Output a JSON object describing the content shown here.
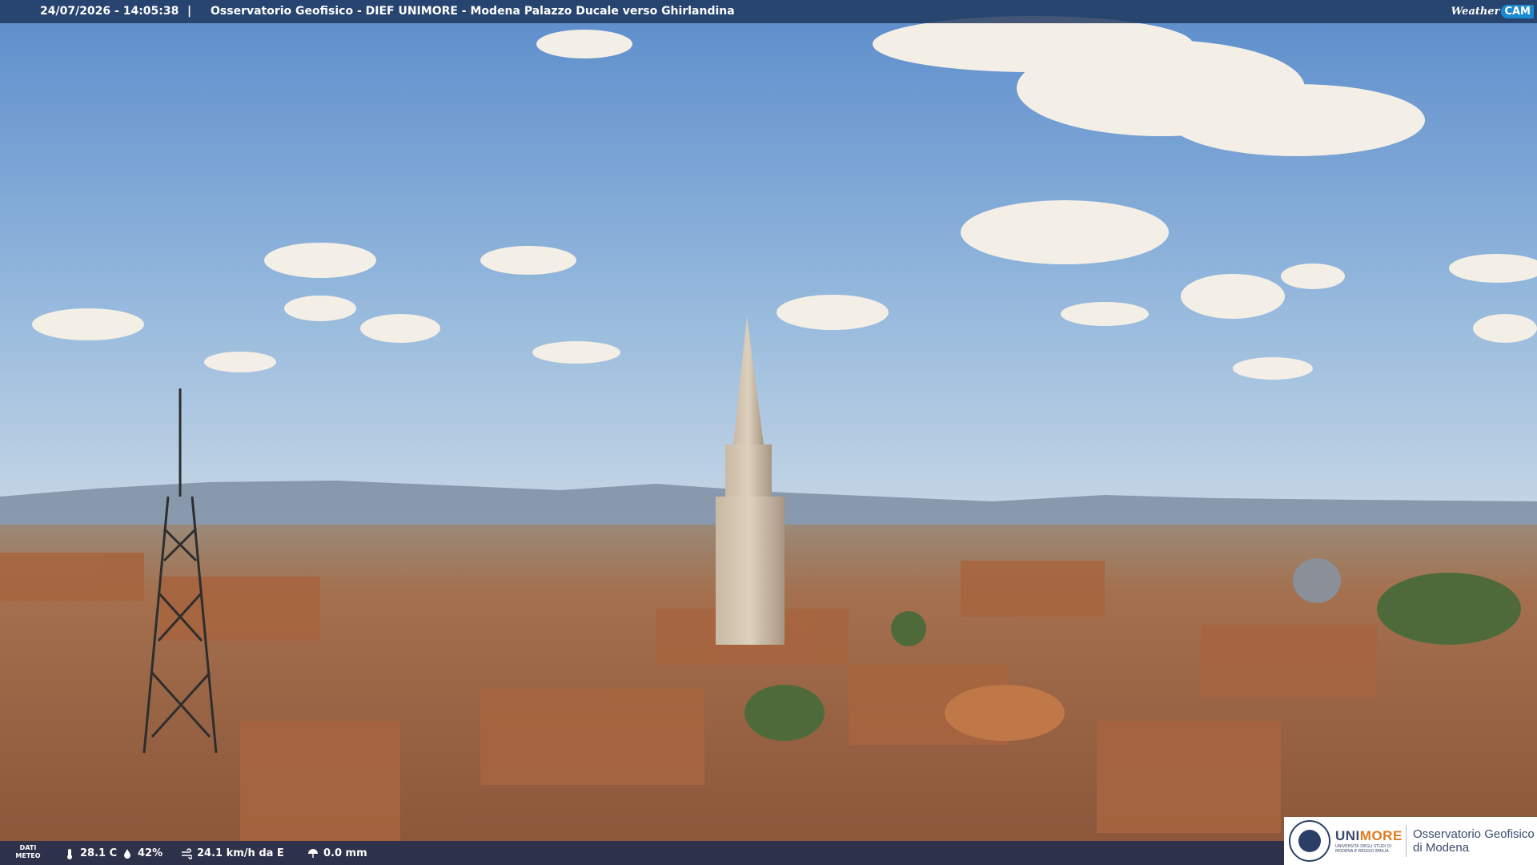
{
  "overlay": {
    "timestamp": "24/07/2026 - 14:05:38",
    "separator": "|",
    "title": "Osservatorio Geofisico - DIEF UNIMORE - Modena Palazzo Ducale verso Ghirlandina"
  },
  "logo": {
    "weather_text": "Weather",
    "cam_text": "CAM",
    "icon": "weathercam-logo"
  },
  "meteo": {
    "label_line1": "DATI",
    "label_line2": "METEO",
    "temperature": "28.1 C",
    "humidity": "42%",
    "wind": "24.1 km/h da E",
    "rain": "0.0 mm",
    "icons": [
      "thermometer-icon",
      "humidity-icon",
      "wind-icon",
      "rain-icon"
    ]
  },
  "branding": {
    "uni_part1": "UNI",
    "uni_part2": "MORE",
    "uni_subtitle1": "UNIVERSITÀ DEGLI STUDI DI",
    "uni_subtitle2": "MODENA E REGGIO EMILIA",
    "observatory_line1": "Osservatorio Geofisico",
    "observatory_line2": "di Modena",
    "colors": {
      "navy": "#3a4a6e",
      "orange": "#e07a20"
    }
  },
  "colors": {
    "overlay_bar": "#1c345c",
    "sky_top": "#5b8ccb",
    "sky_horizon": "#c8d8e6",
    "roof": "#b0704a"
  }
}
